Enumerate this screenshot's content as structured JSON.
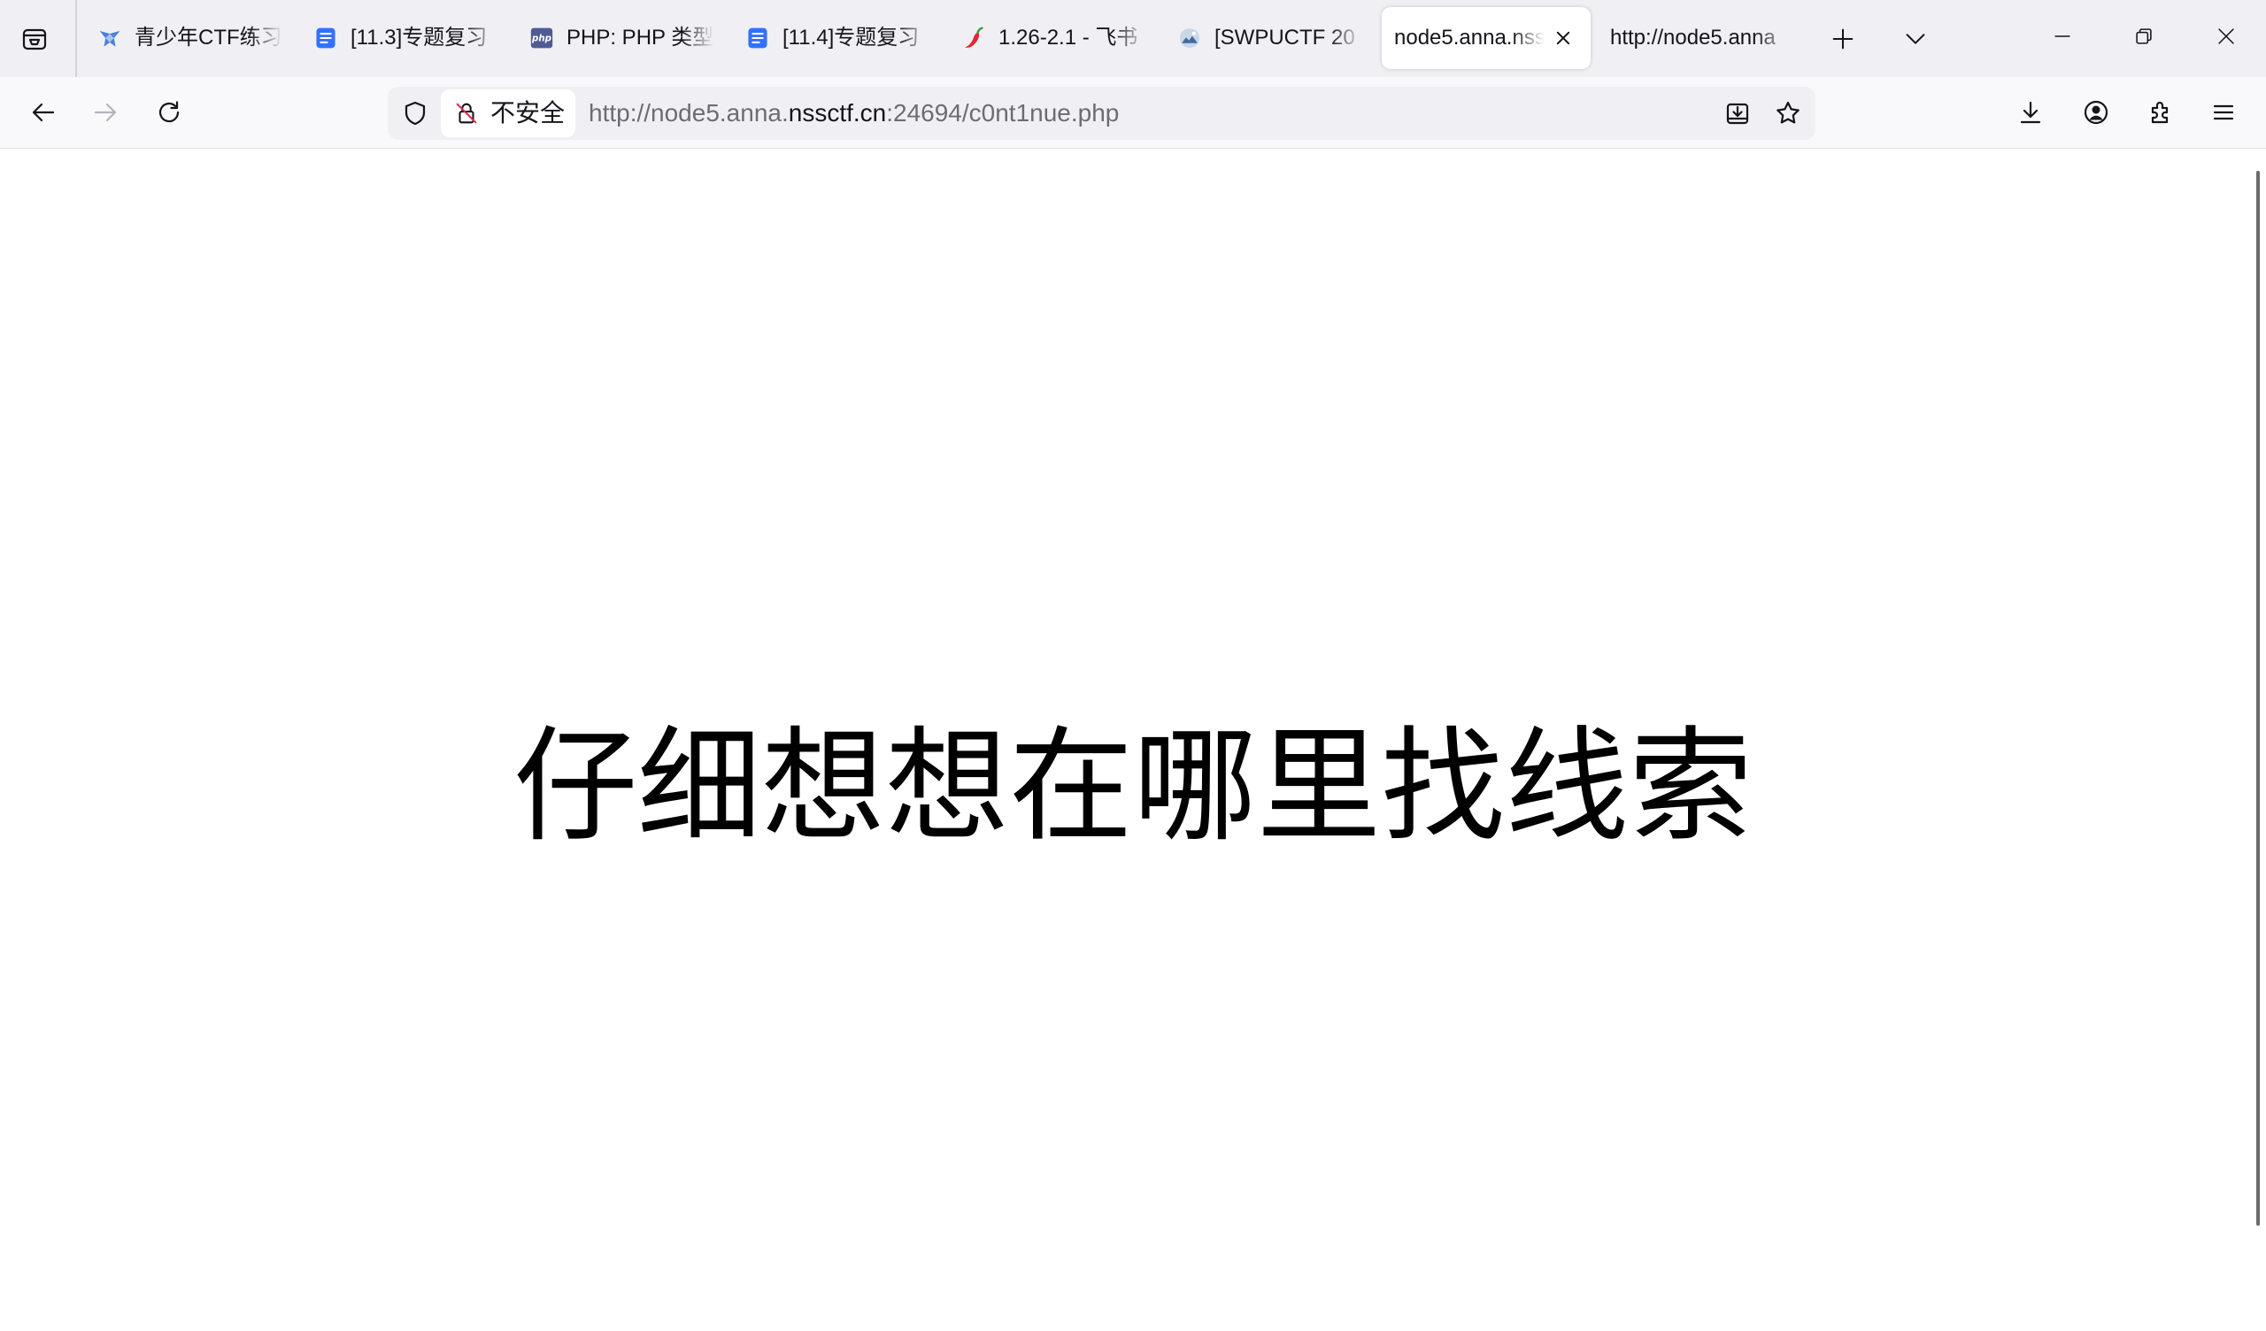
{
  "browser": {
    "tabs": [
      {
        "title": "青少年CTF练习",
        "favicon": "qsnctf-favicon-icon",
        "active": false
      },
      {
        "title": "[11.3]专题复习",
        "favicon": "document-icon",
        "active": false
      },
      {
        "title": "PHP: PHP 类型",
        "favicon": "php-icon",
        "favicon_text": "php",
        "active": false
      },
      {
        "title": "[11.4]专题复习",
        "favicon": "document-icon",
        "active": false
      },
      {
        "title": "1.26-2.1 - 飞书",
        "favicon": "chili-icon",
        "active": false
      },
      {
        "title": "[SWPUCTF 20",
        "favicon": "nssctf-icon",
        "active": false
      },
      {
        "title": "node5.anna.nss",
        "active": true
      },
      {
        "title": "http://node5.anna",
        "active": false
      }
    ],
    "security_label": "不安全",
    "url": {
      "prefix": "http://node5.anna.",
      "domain": "nssctf.cn",
      "suffix": ":24694/c0nt1nue.php"
    },
    "colors": {
      "tab_bar_bg": "#f0f0f4",
      "nav_bar_bg": "#f9f9fb",
      "urlbar_bg": "#f0f0f4",
      "active_tab_bg": "#ffffff",
      "text": "#15141a",
      "url_dim": "#6c6c76"
    }
  },
  "page": {
    "heading": "仔细想想在哪里找线索"
  }
}
